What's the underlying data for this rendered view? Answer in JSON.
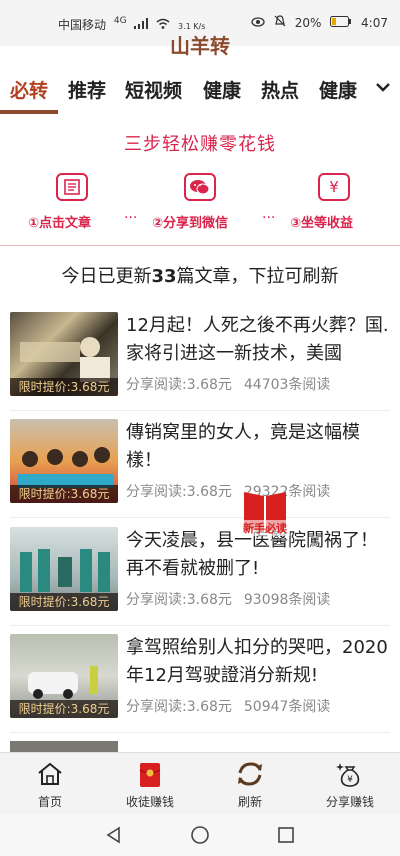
{
  "status_bar": {
    "carrier": "中国移动",
    "network": "4G",
    "speed": "3.1 K/s",
    "battery": "20%",
    "time": "4:07"
  },
  "app": {
    "title": "山羊转"
  },
  "tabs": [
    {
      "label": "必转",
      "active": true
    },
    {
      "label": "推荐",
      "active": false
    },
    {
      "label": "短视频",
      "active": false
    },
    {
      "label": "健康",
      "active": false
    },
    {
      "label": "热点",
      "active": false
    },
    {
      "label": "健康",
      "active": false
    }
  ],
  "tabs_more_icon": "chevron-down-icon",
  "steps": {
    "title": "三步轻松赚零花钱",
    "items": [
      {
        "label": "①点击文章",
        "icon": "article-icon"
      },
      {
        "label": "②分享到微信",
        "icon": "wechat-icon"
      },
      {
        "label": "③坐等收益",
        "icon": "yuan-icon"
      }
    ],
    "separator": "···"
  },
  "update_notice": {
    "prefix": "今日已更新",
    "count": "33",
    "suffix": "篇文章，下拉可刷新"
  },
  "articles": [
    {
      "title": "12月起！人死之後不再火葬？国.家将引进这一新技术，美國",
      "badge": "限时提价:3.68元",
      "share_read": "分享阅读:3.68元",
      "reads": "44703条阅读"
    },
    {
      "title": "傳销窝里的女人，竟是这幅模樣！",
      "badge": "限时提价:3.68元",
      "share_read": "分享阅读:3.68元",
      "reads": "29322条阅读"
    },
    {
      "title": "今天凌晨，县一医醫院闖祸了！再不看就被删了!",
      "badge": "限时提价:3.68元",
      "share_read": "分享阅读:3.68元",
      "reads": "93098条阅读"
    },
    {
      "title": "拿驾照给别人扣分的哭吧，2020年12月驾驶證消分新规!",
      "badge": "限时提价:3.68元",
      "share_read": "分享阅读:3.68元",
      "reads": "50947条阅读"
    }
  ],
  "float_badge": {
    "label": "新手必读"
  },
  "bottom_nav": [
    {
      "label": "首页",
      "icon": "home-icon"
    },
    {
      "label": "收徒赚钱",
      "icon": "red-envelope-icon"
    },
    {
      "label": "刷新",
      "icon": "refresh-icon"
    },
    {
      "label": "分享赚钱",
      "icon": "money-bag-icon"
    }
  ],
  "colors": {
    "brand": "#8b4a2b",
    "accent_red": "#d9254c",
    "badge_text": "#f0d090"
  }
}
